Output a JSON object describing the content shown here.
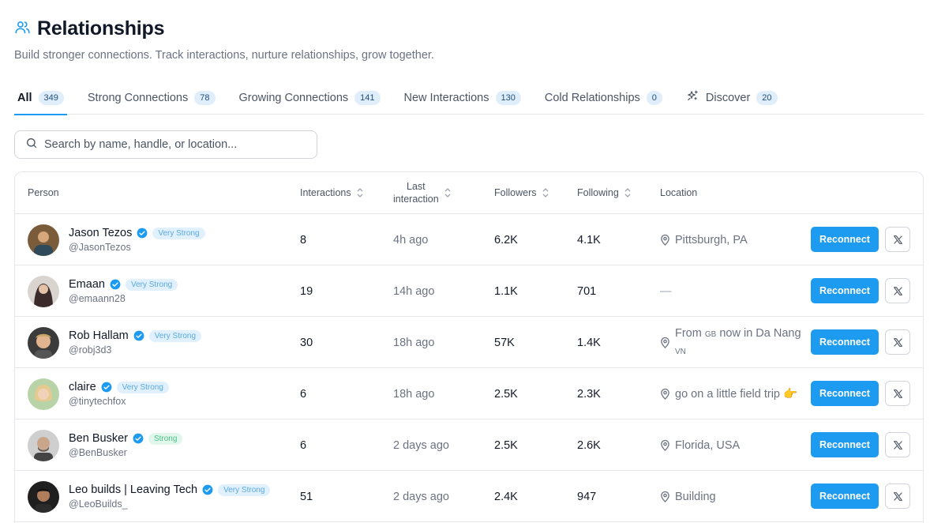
{
  "header": {
    "title": "Relationships",
    "subtitle": "Build stronger connections. Track interactions, nurture relationships, grow together."
  },
  "tabs": [
    {
      "label": "All",
      "count": "349",
      "active": true
    },
    {
      "label": "Strong Connections",
      "count": "78"
    },
    {
      "label": "Growing Connections",
      "count": "141"
    },
    {
      "label": "New Interactions",
      "count": "130"
    },
    {
      "label": "Cold Relationships",
      "count": "0"
    },
    {
      "label": "Discover",
      "count": "20",
      "icon": "sparkles-icon"
    }
  ],
  "search": {
    "placeholder": "Search by name, handle, or location...",
    "value": ""
  },
  "table": {
    "columns": {
      "person": "Person",
      "interactions": "Interactions",
      "last_line1": "Last",
      "last_line2": "interaction",
      "followers": "Followers",
      "following": "Following",
      "location": "Location"
    },
    "reconnect_label": "Reconnect",
    "rows": [
      {
        "name": "Jason Tezos",
        "badge": "Very Strong",
        "badge_type": "vs",
        "handle": "@JasonTezos",
        "interactions": "8",
        "last": "4h ago",
        "followers": "6.2K",
        "following": "4.1K",
        "location": "Pittsburgh, PA",
        "avatar_color": "#7a5c3a"
      },
      {
        "name": "Emaan",
        "badge": "Very Strong",
        "badge_type": "vs",
        "handle": "@emaann28",
        "interactions": "19",
        "last": "14h ago",
        "followers": "1.1K",
        "following": "701",
        "location": "—",
        "avatar_color": "#3a2a2a"
      },
      {
        "name": "Rob Hallam",
        "badge": "Very Strong",
        "badge_type": "vs",
        "handle": "@robj3d3",
        "interactions": "30",
        "last": "18h ago",
        "followers": "57K",
        "following": "1.4K",
        "location_parts": [
          "From ",
          "GB",
          " now in Da Nang ",
          "VN"
        ],
        "avatar_color": "#a0714f"
      },
      {
        "name": "claire",
        "badge": "Very Strong",
        "badge_type": "vs",
        "handle": "@tinytechfox",
        "interactions": "6",
        "last": "18h ago",
        "followers": "2.5K",
        "following": "2.3K",
        "location": "go on a little field trip 👉",
        "avatar_color": "#c9a56a"
      },
      {
        "name": "Ben Busker",
        "badge": "Strong",
        "badge_type": "s",
        "handle": "@BenBusker",
        "interactions": "6",
        "last": "2 days ago",
        "followers": "2.5K",
        "following": "2.6K",
        "location": "Florida, USA",
        "avatar_color": "#8a8a8a"
      },
      {
        "name": "Leo builds | Leaving Tech",
        "badge": "Very Strong",
        "badge_type": "vs",
        "handle": "@LeoBuilds_",
        "interactions": "51",
        "last": "2 days ago",
        "followers": "2.4K",
        "following": "947",
        "location": "Building",
        "avatar_color": "#1f1f1f"
      }
    ]
  },
  "colors": {
    "accent": "#1d9bf0",
    "badge_very_strong_bg": "#e0f0fc",
    "badge_strong_bg": "#e1f7ec"
  }
}
